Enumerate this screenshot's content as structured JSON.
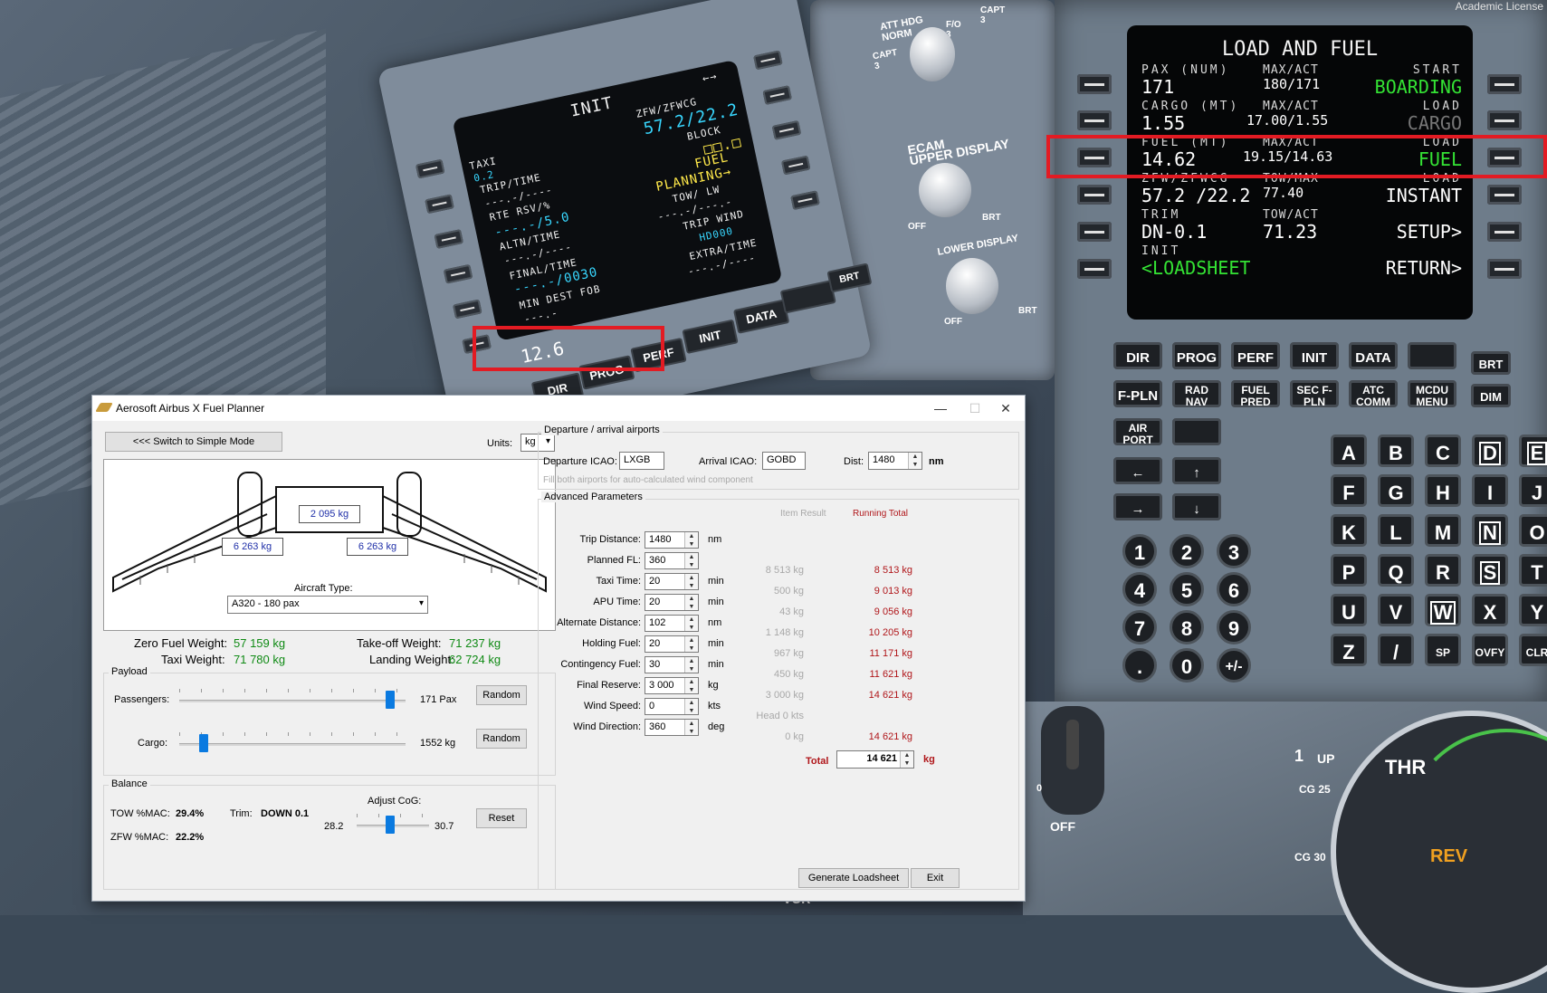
{
  "left_mcdu": {
    "title": "INIT",
    "lines": {
      "zfw_label": "ZFW/ZFWCG",
      "zfw_value": "57.2/22.2",
      "block_label": "BLOCK",
      "block_value": "□□.□",
      "fuel_planning": "FUEL\nPLANNING→",
      "taxi_label": "TAXI",
      "taxi_value": "0.2",
      "trip_label": "TRIP/TIME",
      "trip_value": "---.-/----",
      "rte_label": "RTE RSV/%",
      "rte_value": "---.-/5.0",
      "altn_label": "ALTN/TIME",
      "altn_value": "---.-/----",
      "final_label": "FINAL/TIME",
      "final_value": "---.-/0030",
      "min_label": "MIN DEST FOB",
      "min_value": "---.-",
      "tow_label": "TOW/   LW",
      "tow_value": "---.-/---.-",
      "trip_wind_label": "TRIP WIND",
      "trip_wind_value": "HD000",
      "extra_label": "EXTRA/TIME",
      "extra_value": "---.-/----",
      "arrow": "←→"
    },
    "scratchpad": "12.6",
    "keys": [
      "DIR",
      "PROG",
      "PERF",
      "INIT",
      "DATA",
      "",
      "BRT",
      "FUEL PRED",
      "SEC F-PLN",
      "ATC COMM",
      "MCDU MENU",
      "DIM",
      "D",
      "E"
    ]
  },
  "knobs": {
    "att_hdg": "ATT HDG\nNORM",
    "capt_left": "CAPT\n3",
    "fo": "F/O\n3",
    "capt_right": "CAPT\n3",
    "ecam": "ECAM\nUPPER DISPLAY",
    "lower": "LOWER DISPLAY",
    "off1": "OFF",
    "brt1": "BRT",
    "off2": "OFF",
    "brt2": "BRT"
  },
  "right_mcdu": {
    "license": "Academic License",
    "title": "LOAD AND FUEL",
    "rows": [
      {
        "l_lbl": "PAX (NUM)",
        "l_val": "171",
        "c_lbl": "MAX/ACT",
        "c_val": "180/171",
        "r_lbl": "START",
        "r_val": "BOARDING",
        "r_color": "green"
      },
      {
        "l_lbl": "CARGO (MT)",
        "l_val": "1.55",
        "c_lbl": "MAX/ACT",
        "c_val": "17.00/1.55",
        "r_lbl": "LOAD",
        "r_val": "CARGO",
        "r_color": "gray"
      },
      {
        "l_lbl": "FUEL (MT)",
        "l_val": "14.62",
        "c_lbl": "MAX/ACT",
        "c_val": "19.15/14.63",
        "r_lbl": "LOAD",
        "r_val": "FUEL",
        "r_color": "green"
      },
      {
        "l_lbl": "ZFW/ZFWCG",
        "l_val": "57.2 /22.2",
        "c_lbl": "TOW/MAX",
        "c_val": "77.40",
        "r_lbl": "LOAD",
        "r_val": "INSTANT",
        "r_color": "white"
      },
      {
        "l_lbl": "TRIM",
        "l_val": "DN-0.1",
        "c_lbl": "TOW/ACT",
        "c_val": "71.23",
        "r_lbl": "",
        "r_val": "SETUP>",
        "r_color": "white"
      },
      {
        "l_lbl": "INIT",
        "l_val": "<LOADSHEET",
        "c_lbl": "",
        "c_val": "",
        "r_lbl": "",
        "r_val": "RETURN>",
        "r_color": "white"
      }
    ],
    "func_keys": [
      "DIR",
      "PROG",
      "PERF",
      "INIT",
      "DATA",
      "",
      "BRT",
      "F-PLN",
      "RAD NAV",
      "FUEL PRED",
      "SEC F-PLN",
      "ATC COMM",
      "MCDU MENU",
      "DIM",
      "AIR PORT",
      ""
    ],
    "letters": [
      "A",
      "B",
      "C",
      "D",
      "E",
      "F",
      "G",
      "H",
      "I",
      "J",
      "K",
      "L",
      "M",
      "N",
      "O",
      "P",
      "Q",
      "R",
      "S",
      "T",
      "U",
      "V",
      "W",
      "X",
      "Y",
      "Z",
      "/",
      "SP",
      "OVFY",
      "CLR"
    ],
    "numbers": [
      "1",
      "2",
      "3",
      "4",
      "5",
      "6",
      "7",
      "8",
      "9",
      ".",
      "0",
      "+/-"
    ],
    "arrows": [
      "←",
      "↑",
      "→",
      "↓"
    ]
  },
  "background_marks": {
    "arc_label1": "1",
    "arc_label2": "UP",
    "arc_label3": "THR",
    "arc_label4": "CG 25",
    "arc_label5": "CG 30",
    "arc_label6": "REV",
    "vor": "VOR",
    "off": "OFF",
    "zero": "0"
  },
  "window": {
    "title": "Aerosoft Airbus X Fuel Planner",
    "controls": {
      "minimize": "—",
      "maximize": "☐",
      "close": "✕"
    },
    "simple_mode_button": "<<< Switch to Simple Mode",
    "units_label": "Units:",
    "units_value": "kg",
    "aircraft": {
      "center_tank": "2 095 kg",
      "left_tank": "6 263 kg",
      "right_tank": "6 263 kg",
      "type_label": "Aircraft Type:",
      "type_value": "A320 - 180 pax"
    },
    "weights": {
      "zfw_label": "Zero Fuel Weight:",
      "zfw_value": "57 159 kg",
      "tow_label": "Take-off Weight:",
      "tow_value": "71 237 kg",
      "taxi_label": "Taxi Weight:",
      "taxi_value": "71 780 kg",
      "lw_label": "Landing Weight:",
      "lw_value": "62 724 kg"
    },
    "payload": {
      "group": "Payload",
      "pax_label": "Passengers:",
      "pax_value": "171 Pax",
      "pax_fraction": 0.95,
      "cargo_label": "Cargo:",
      "cargo_value": "1552 kg",
      "cargo_fraction": 0.09,
      "random": "Random"
    },
    "balance": {
      "group": "Balance",
      "tow_mac_label": "TOW %MAC:",
      "tow_mac_value": "29.4%",
      "zfw_mac_label": "ZFW %MAC:",
      "zfw_mac_value": "22.2%",
      "trim_label": "Trim:",
      "trim_value": "DOWN 0.1",
      "cog_label": "Adjust CoG:",
      "cog_min": "28.2",
      "cog_max": "30.7",
      "cog_fraction": 0.45,
      "reset": "Reset"
    },
    "airports": {
      "group": "Departure / arrival airports",
      "dep_label": "Departure ICAO:",
      "dep_value": "LXGB",
      "arr_label": "Arrival ICAO:",
      "arr_value": "GOBD",
      "dist_label": "Dist:",
      "dist_value": "1480",
      "dist_unit": "nm",
      "hint": "Fill both airports for auto-calculated wind component"
    },
    "advanced": {
      "group": "Advanced Parameters",
      "col_item": "Item Result",
      "col_running": "Running Total",
      "rows": [
        {
          "label": "Trip Distance:",
          "value": "1480",
          "unit": "nm",
          "item": "",
          "running": ""
        },
        {
          "label": "Planned FL:",
          "value": "360",
          "unit": "",
          "item": "8 513 kg",
          "running": "8 513 kg"
        },
        {
          "label": "Taxi Time:",
          "value": "20",
          "unit": "min",
          "item": "500 kg",
          "running": "9 013 kg"
        },
        {
          "label": "APU Time:",
          "value": "20",
          "unit": "min",
          "item": "43 kg",
          "running": "9 056 kg"
        },
        {
          "label": "Alternate Distance:",
          "value": "102",
          "unit": "nm",
          "item": "1 148 kg",
          "running": "10 205 kg"
        },
        {
          "label": "Holding Fuel:",
          "value": "20",
          "unit": "min",
          "item": "967 kg",
          "running": "11 171 kg"
        },
        {
          "label": "Contingency Fuel:",
          "value": "30",
          "unit": "min",
          "item": "450 kg",
          "running": "11 621 kg"
        },
        {
          "label": "Final Reserve:",
          "value": "3 000",
          "unit": "kg",
          "item": "3 000 kg",
          "running": "14 621 kg"
        },
        {
          "label": "Wind Speed:",
          "value": "0",
          "unit": "kts",
          "item": "Head 0 kts",
          "running": ""
        },
        {
          "label": "Wind Direction:",
          "value": "360",
          "unit": "deg",
          "item": "0 kg",
          "running": "14 621 kg"
        }
      ],
      "total_label": "Total",
      "total_value": "14 621",
      "total_unit": "kg"
    },
    "generate_button": "Generate Loadsheet",
    "exit_button": "Exit"
  }
}
